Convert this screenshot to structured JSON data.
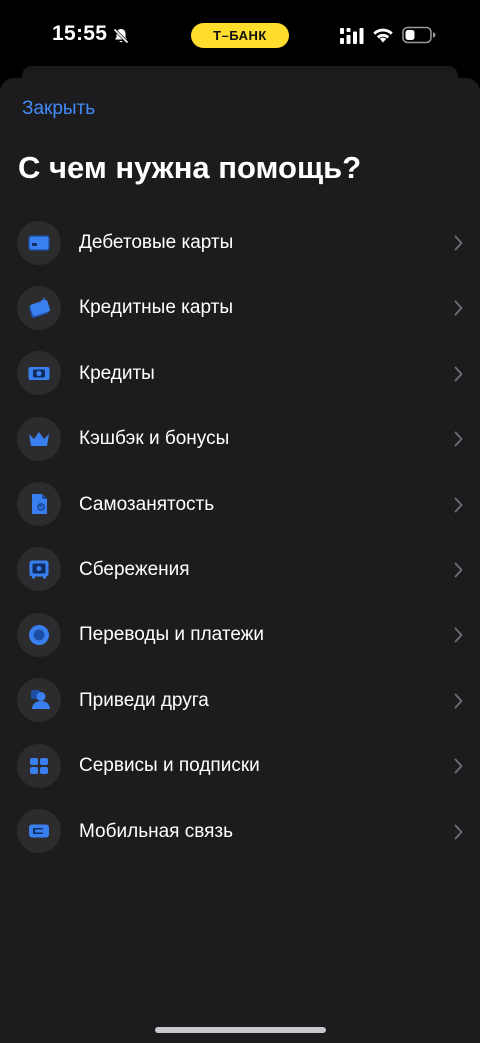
{
  "status_bar": {
    "time": "15:55",
    "carrier": "Т–БАНК"
  },
  "sheet": {
    "close_label": "Закрыть",
    "title": "С чем нужна помощь?"
  },
  "menu": {
    "items": [
      {
        "label": "Дебетовые карты",
        "icon": "debit-card-icon"
      },
      {
        "label": "Кредитные карты",
        "icon": "credit-card-icon"
      },
      {
        "label": "Кредиты",
        "icon": "loan-banknote-icon"
      },
      {
        "label": "Кэшбэк и бонусы",
        "icon": "crown-icon"
      },
      {
        "label": "Самозанятость",
        "icon": "self-employed-document-icon"
      },
      {
        "label": "Сбережения",
        "icon": "safe-icon"
      },
      {
        "label": "Переводы и платежи",
        "icon": "transfer-circle-icon"
      },
      {
        "label": "Приведи друга",
        "icon": "invite-friend-icon"
      },
      {
        "label": "Сервисы и подписки",
        "icon": "services-grid-icon"
      },
      {
        "label": "Мобильная связь",
        "icon": "sim-card-icon"
      }
    ]
  },
  "colors": {
    "accent": "#428bf9",
    "icon_blue": "#3a7ff0",
    "icon_blue_dark": "#1c4fa3",
    "sheet_background": "#1c1c1e",
    "icon_circle": "#2c2c2e",
    "carrier_pill": "#ffdd2d"
  }
}
